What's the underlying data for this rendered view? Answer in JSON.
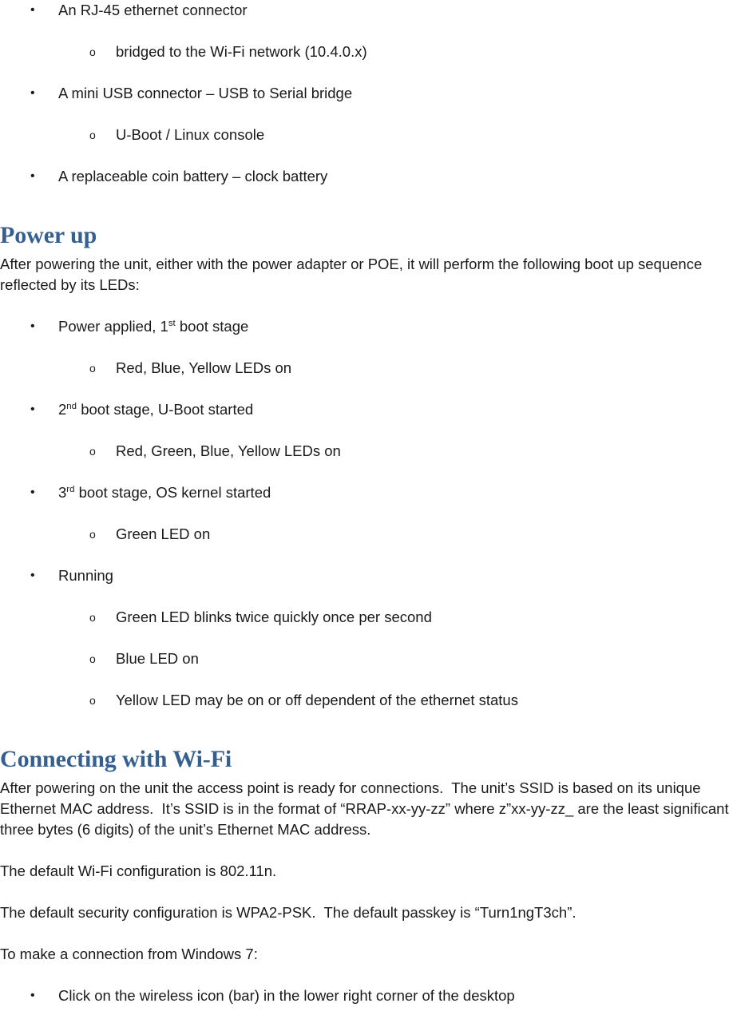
{
  "document": {
    "accent_color": "#365F91",
    "text_color": "#1a1a1a",
    "bullet_level1": "•",
    "bullet_level2": "o"
  },
  "hardware_list": {
    "item1": "An RJ-45 ethernet connector",
    "item1_sub1": "bridged to the Wi-Fi network (10.4.0.x)",
    "item2": "A mini USB connector – USB to Serial bridge",
    "item2_sub1": "U-Boot / Linux console",
    "item3": "A replaceable coin battery – clock battery"
  },
  "power_up": {
    "heading": "Power up",
    "intro": "After powering the unit, either with the power adapter or POE, it will perform the following boot up sequence reflected by its LEDs:",
    "stage1_pre": "Power applied, 1",
    "stage1_sup": "st",
    "stage1_post": " boot stage",
    "stage1_sub1": "Red, Blue, Yellow LEDs on",
    "stage2_pre": "2",
    "stage2_sup": "nd",
    "stage2_post": " boot stage, U-Boot started",
    "stage2_sub1": "Red, Green, Blue, Yellow LEDs on",
    "stage3_pre": "3",
    "stage3_sup": "rd",
    "stage3_post": " boot stage, OS kernel started",
    "stage3_sub1": "Green LED on",
    "stage4": "Running",
    "stage4_sub1": "Green LED blinks twice quickly once per second",
    "stage4_sub2": "Blue LED on",
    "stage4_sub3": "Yellow LED may be on or off dependent of the ethernet status"
  },
  "connecting_wifi": {
    "heading": "Connecting with Wi-Fi",
    "para1": "After powering on the unit the access point is ready for connections.  The unit’s SSID is based on its unique Ethernet MAC address.  It’s SSID is in the format of “RRAP-xx-yy-zz” where z”xx-yy-zz_ are the least significant three bytes (6 digits) of the unit’s Ethernet MAC address.",
    "para2": "The default Wi-Fi configuration is 802.11n.",
    "para3": "The default security configuration is WPA2-PSK.  The default passkey is “Turn1ngT3ch”.",
    "para4": "To make a connection from Windows 7:",
    "step1": "Click on the wireless icon (bar) in the lower right corner of the desktop"
  }
}
